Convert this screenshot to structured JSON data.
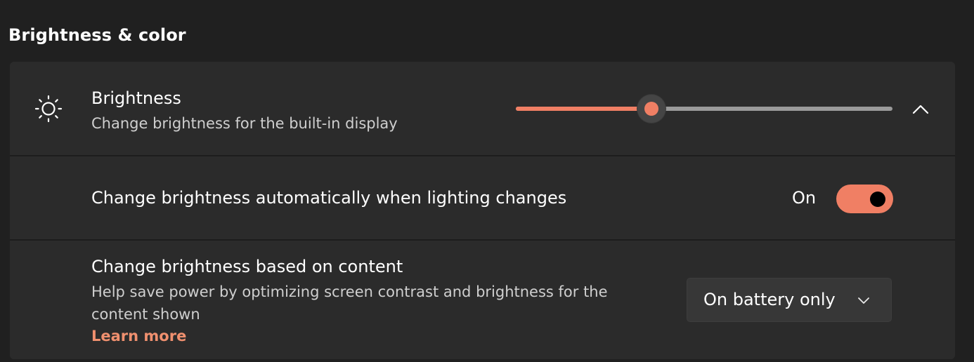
{
  "section": {
    "title": "Brightness & color"
  },
  "brightness": {
    "icon": "sun-icon",
    "title": "Brightness",
    "subtitle": "Change brightness for the built-in display",
    "slider_value_percent": 36,
    "expand_icon": "chevron-up-icon"
  },
  "auto_brightness": {
    "label": "Change brightness automatically when lighting changes",
    "state_label": "On",
    "enabled": true
  },
  "content_brightness": {
    "title": "Change brightness based on content",
    "description": "Help save power by optimizing screen contrast and brightness for the content shown",
    "link_label": "Learn more",
    "selected_option": "On battery only",
    "dropdown_icon": "chevron-down-icon"
  },
  "colors": {
    "accent": "#f07f64",
    "link": "#f0906f",
    "card": "#2b2b2b",
    "background": "#202020"
  }
}
